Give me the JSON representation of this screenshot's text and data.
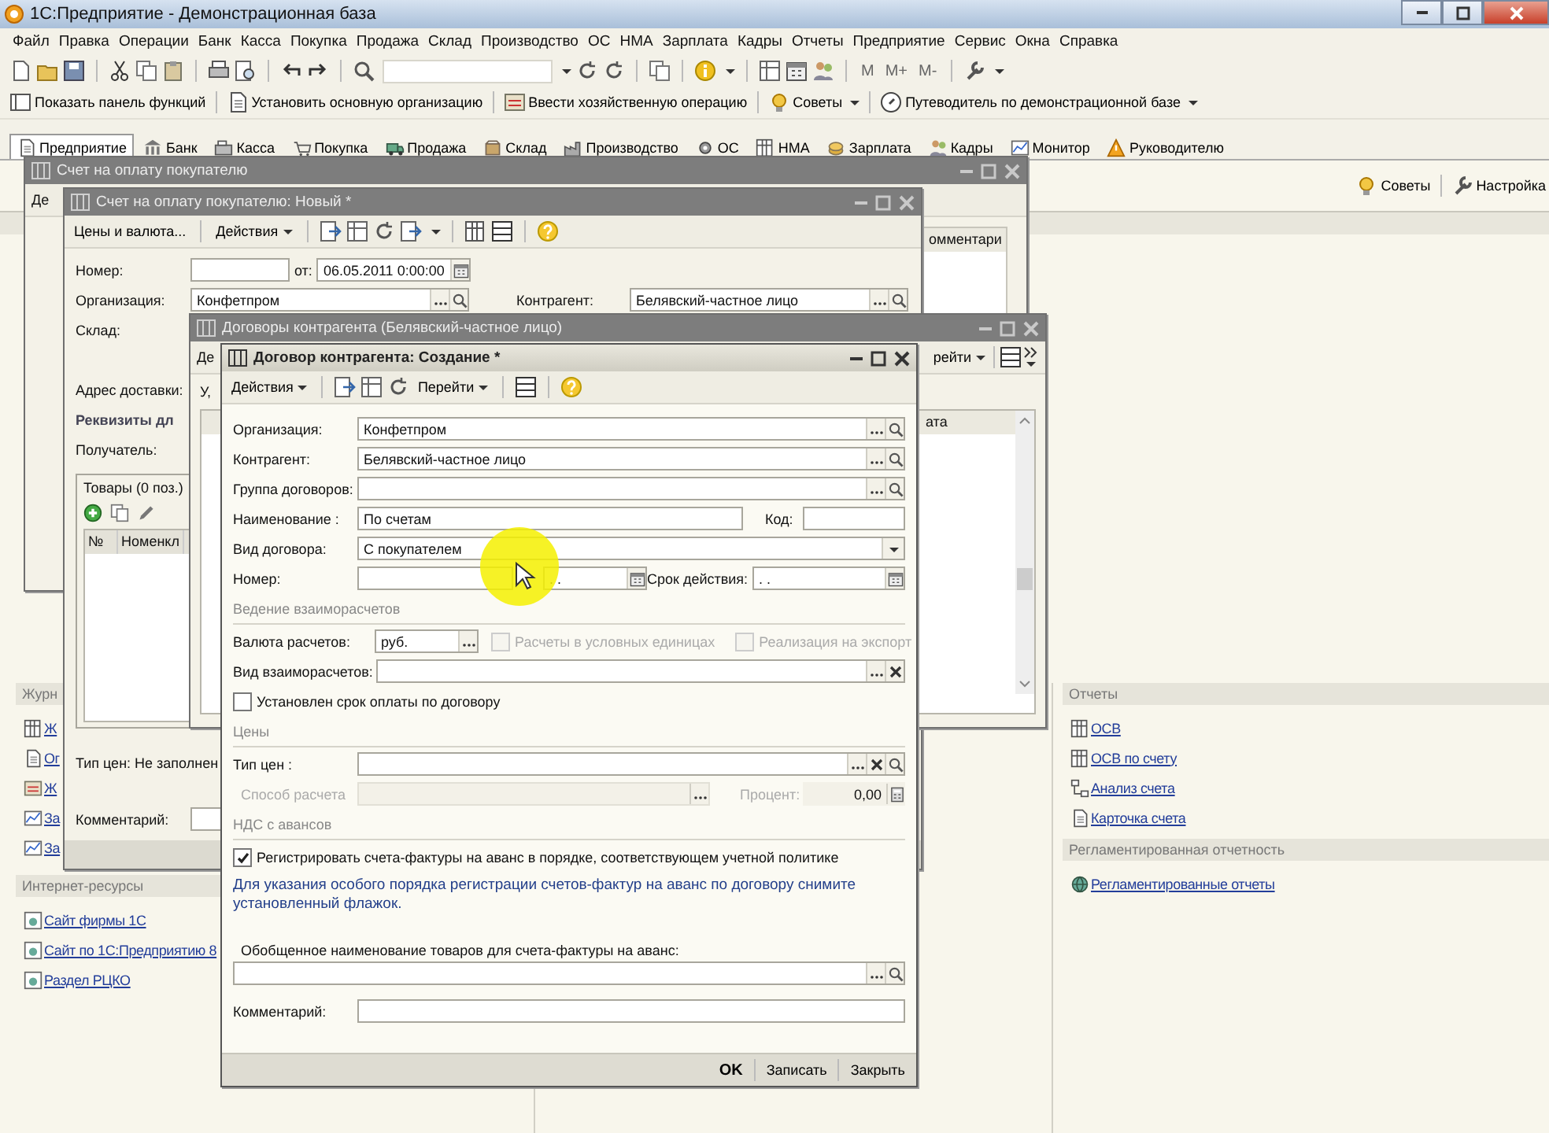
{
  "window": {
    "title": "1С:Предприятие - Демонстрационная база"
  },
  "menu": [
    "Файл",
    "Правка",
    "Операции",
    "Банк",
    "Касса",
    "Покупка",
    "Продажа",
    "Склад",
    "Производство",
    "ОС",
    "НМА",
    "Зарплата",
    "Кадры",
    "Отчеты",
    "Предприятие",
    "Сервис",
    "Окна",
    "Справка"
  ],
  "toolbar": {
    "memory_buttons": [
      "M",
      "M+",
      "M-"
    ]
  },
  "command_bar": [
    {
      "label": "Показать панель функций",
      "dropdown": false
    },
    {
      "label": "Установить основную организацию",
      "dropdown": false
    },
    {
      "label": "Ввести хозяйственную операцию",
      "dropdown": false
    },
    {
      "label": "Советы",
      "dropdown": true
    },
    {
      "label": "Путеводитель по демонстрационной базе",
      "dropdown": true
    }
  ],
  "tabs": [
    {
      "label": "Предприятие",
      "selected": true
    },
    {
      "label": "Банк",
      "selected": false
    },
    {
      "label": "Касса",
      "selected": false
    },
    {
      "label": "Покупка",
      "selected": false
    },
    {
      "label": "Продажа",
      "selected": false
    },
    {
      "label": "Склад",
      "selected": false
    },
    {
      "label": "Производство",
      "selected": false
    },
    {
      "label": "ОС",
      "selected": false
    },
    {
      "label": "НМА",
      "selected": false
    },
    {
      "label": "Зарплата",
      "selected": false
    },
    {
      "label": "Кадры",
      "selected": false
    },
    {
      "label": "Монитор",
      "selected": false
    },
    {
      "label": "Руководителю",
      "selected": false
    }
  ],
  "desktop": {
    "actions": [
      "Советы",
      "Настройка"
    ],
    "journals": {
      "title": "Журн",
      "links": [
        "Ж",
        "Ог",
        "Ж",
        "За",
        "За"
      ]
    },
    "internet": {
      "title": "Интернет-ресурсы",
      "links": [
        "Сайт фирмы 1С",
        "Сайт по 1С:Предприятию 8",
        "Раздел РЦКО"
      ]
    },
    "reports": {
      "title": "Отчеты",
      "links": [
        "ОСВ",
        "ОСВ по счету",
        "Анализ счета",
        "Карточка счета"
      ]
    },
    "regulated": {
      "title": "Регламентированная отчетность",
      "links": [
        "Регламентированные отчеты"
      ]
    }
  },
  "invoice_list_window": {
    "title": "Счет на оплату покупателю",
    "toolbar": "Де",
    "column": "омментари"
  },
  "invoice_window": {
    "title": "Счет на оплату покупателю: Новый *",
    "toolbar": [
      {
        "label": "Цены и валюта...",
        "dropdown": false
      },
      {
        "label": "Действия",
        "dropdown": true
      }
    ],
    "number_label": "Номер:",
    "date_label": "от:",
    "date": "06.05.2011 0:00:00",
    "organization_label": "Организация:",
    "organization": "Конфетпром",
    "counterparty_label": "Контрагент:",
    "counterparty": "Белявский-частное лицо",
    "warehouse_label": "Склад:",
    "address_label": "Адрес доставки:",
    "requisites": "Реквизиты дл",
    "recipient_label": "Получатель:",
    "goods_tab": "Товары (0 поз.)",
    "columns": [
      "№",
      "Номенкл"
    ],
    "price_type": "Тип цен: Не заполнен",
    "comment_label": "Комментарий:"
  },
  "contracts_window": {
    "title": "Договоры контрагента (Белявский-частное лицо)",
    "toolbar_left": "Де",
    "toolbar_right": "рейти",
    "filter": "У,",
    "column": "ата"
  },
  "contract_dialog": {
    "title": "Договор контрагента: Создание *",
    "toolbar": [
      {
        "label": "Действия",
        "dropdown": true
      },
      {
        "label": "Перейти",
        "dropdown": true
      }
    ],
    "rows": [
      {
        "kind": "ref",
        "label": "Организация:",
        "value": "Конфетпром"
      },
      {
        "kind": "ref",
        "label": "Контрагент:",
        "value": "Белявский-частное лицо"
      },
      {
        "kind": "ref",
        "label": "Группа договоров:"
      },
      {
        "kind": "name",
        "label": "Наименование :",
        "value": "По счетам",
        "code_label": "Код:"
      },
      {
        "kind": "select",
        "label": "Вид договора:",
        "value": "С покупателем"
      },
      {
        "kind": "number",
        "label": "Номер:",
        "date": ". .",
        "term_label": "Срок действия:",
        "term": ". ."
      },
      {
        "kind": "section",
        "label": "Ведение взаиморасчетов"
      },
      {
        "kind": "currency",
        "label": "Валюта расчетов:",
        "value": "руб.",
        "options": [
          {
            "label": "Расчеты в условных единицах",
            "checked": false,
            "disabled": true
          },
          {
            "label": "Реализация на экспорт",
            "checked": false,
            "disabled": true
          }
        ]
      },
      {
        "kind": "ref_clear",
        "label": "Вид взаиморасчетов:"
      },
      {
        "kind": "checkbox",
        "label": "Установлен срок оплаты по договору",
        "checked": false
      },
      {
        "kind": "section",
        "label": "Цены"
      },
      {
        "kind": "ref_full",
        "label": "Тип цен :"
      },
      {
        "kind": "calc",
        "label": "Способ расчета",
        "percent_label": "Процент:",
        "percent": "0,00",
        "disabled": true
      },
      {
        "kind": "section",
        "label": "НДС с авансов"
      },
      {
        "kind": "checkbox",
        "label": "Регистрировать счета-фактуры на аванс в порядке, соответствующем учетной политике",
        "checked": true
      },
      {
        "kind": "note",
        "label": "Для указания особого порядка регистрации счетов-фактур на аванс по договору снимите установленный флажок."
      },
      {
        "kind": "wide_ref",
        "label": "Обобщенное наименование товаров для счета-фактуры на аванс:"
      },
      {
        "kind": "text",
        "label": "Комментарий:"
      }
    ],
    "buttons": [
      {
        "label": "OK",
        "default": true
      },
      {
        "label": "Записать",
        "default": false
      },
      {
        "label": "Закрыть",
        "default": false
      }
    ]
  }
}
